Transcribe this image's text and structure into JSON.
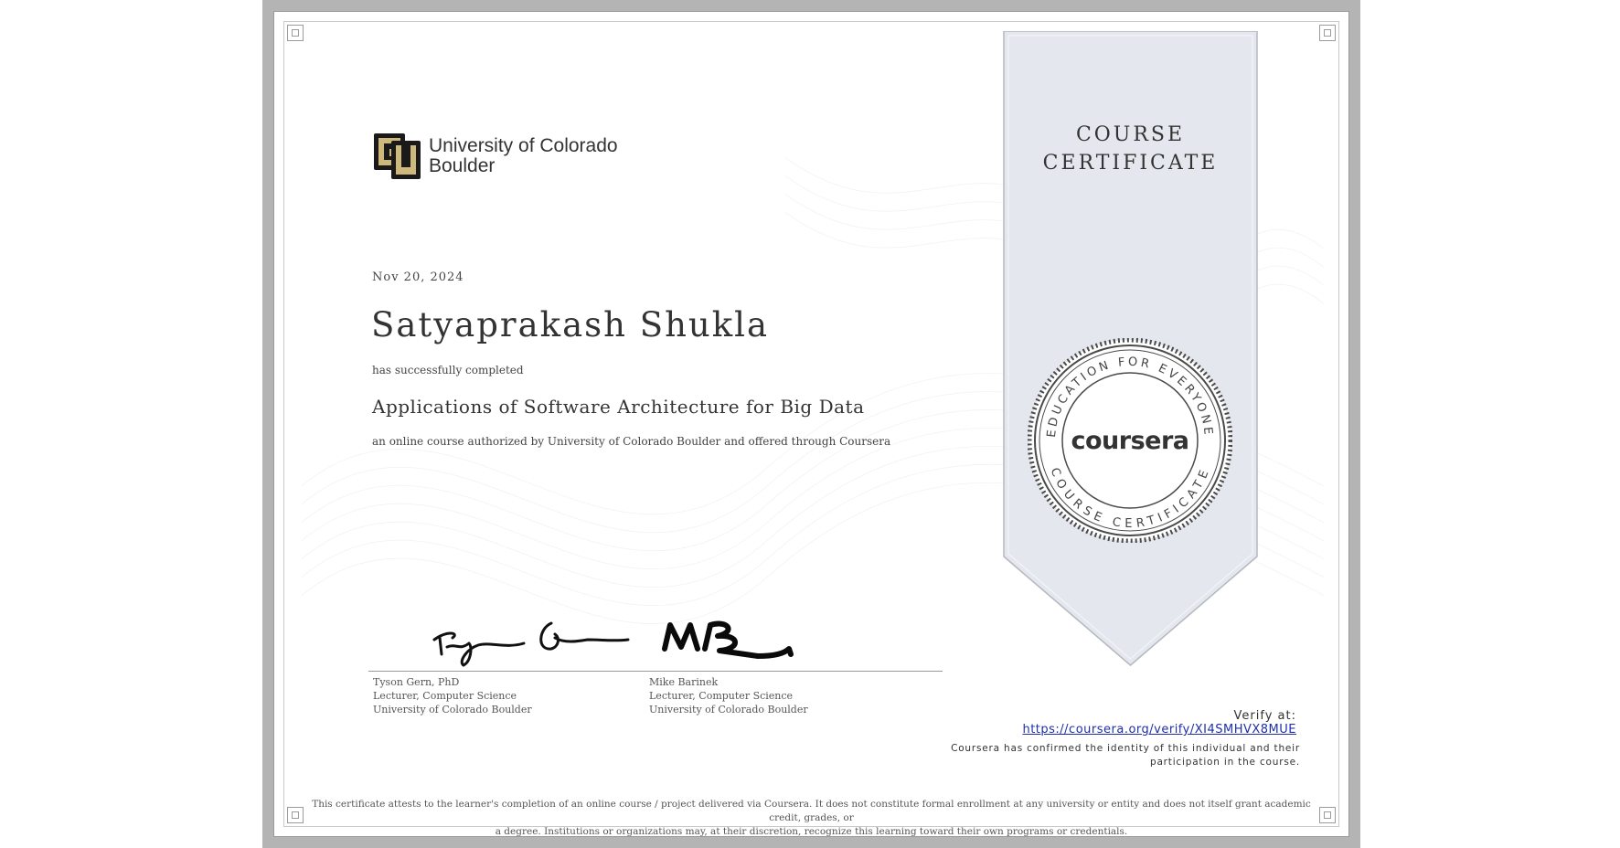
{
  "certificate": {
    "ribbon_title_line1": "COURSE",
    "ribbon_title_line2": "CERTIFICATE",
    "date": "Nov 20, 2024",
    "recipient_name": "Satyaprakash Shukla",
    "completed_label": "has successfully completed",
    "course_name": "Applications of Software Architecture for Big Data",
    "course_description": "an online course authorized by University of Colorado Boulder and offered through Coursera"
  },
  "logo": {
    "line1": "University of Colorado",
    "line2": "Boulder",
    "icon": "cu-boulder-logo-icon",
    "colors": {
      "gold": "#cfb87c",
      "black": "#1a1a1a"
    }
  },
  "seal": {
    "top_arc": "EDUCATION FOR EVERYONE",
    "bottom_arc": "COURSE CERTIFICATE",
    "center": "coursera"
  },
  "signatories": [
    {
      "name": "Tyson Gern, PhD",
      "title": "Lecturer, Computer Science",
      "institution": "University of Colorado Boulder"
    },
    {
      "name": "Mike Barinek",
      "title": "Lecturer, Computer Science",
      "institution": "University of Colorado Boulder"
    }
  ],
  "verify": {
    "label": "Verify at:",
    "url": "https://coursera.org/verify/XI4SMHVX8MUE",
    "note_line1": "Coursera has confirmed the identity of this individual and their",
    "note_line2": "participation in the course."
  },
  "disclaimer": {
    "line1": "This certificate attests to the learner's completion of an online course / project delivered via Coursera. It does not constitute formal enrollment at any university or entity and does not itself grant academic credit, grades, or",
    "line2": "a degree. Institutions or organizations may, at their discretion, recognize this learning toward their own programs or credentials."
  },
  "colors": {
    "ribbon_fill": "#e4e8ee",
    "ribbon_stroke": "#b3b8c0",
    "frame_gray": "#b4b4b4",
    "link": "#1f2fa8"
  }
}
